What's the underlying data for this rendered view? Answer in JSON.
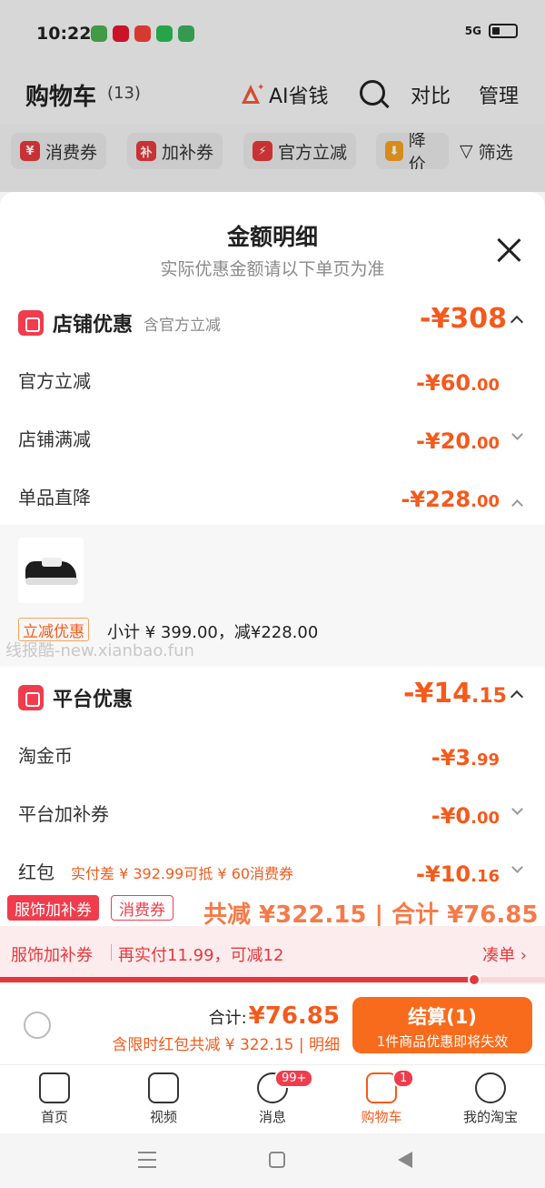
{
  "status": {
    "time": "10:22",
    "network": "5G"
  },
  "header": {
    "title": "购物车",
    "count": "(13)",
    "ai_label": "AI省钱",
    "compare": "对比",
    "manage": "管理"
  },
  "filters": [
    {
      "icon": "¥",
      "label": "消费券"
    },
    {
      "icon": "补",
      "label": "加补券"
    },
    {
      "icon": "⚡",
      "label": "官方立减"
    },
    {
      "icon": "⬇",
      "label": "降价"
    },
    {
      "icon": "▽",
      "label": "筛选"
    }
  ],
  "sheet": {
    "title": "金额明细",
    "subtitle": "实际优惠金额请以下单页为准",
    "store": {
      "title": "店铺优惠",
      "note": "含官方立减",
      "amount": "-¥308",
      "rows": [
        {
          "label": "官方立减",
          "amount_int": "-¥60",
          "amount_dec": ".00"
        },
        {
          "label": "店铺满减",
          "amount_int": "-¥20",
          "amount_dec": ".00"
        },
        {
          "label": "单品直降",
          "amount_int": "-¥228",
          "amount_dec": ".00"
        }
      ]
    },
    "product": {
      "tag": "立减优惠",
      "subtotal": "小计 ¥ 399.00，减¥228.00"
    },
    "watermark": "线报酷-new.xianbao.fun",
    "platform": {
      "title": "平台优惠",
      "amount_int": "-¥14",
      "amount_dec": ".15",
      "rows": [
        {
          "label": "淘金币",
          "amount_int": "-¥3",
          "amount_dec": ".99"
        },
        {
          "label": "平台加补券",
          "amount_int": "-¥0",
          "amount_dec": ".00"
        },
        {
          "label": "红包",
          "note": "实付差 ¥ 392.99可抵 ¥ 60消费券",
          "amount_int": "-¥10",
          "amount_dec": ".16"
        }
      ]
    }
  },
  "tags": {
    "red": "服饰加补券",
    "outline": "消费券",
    "peek": "共减 ¥322.15 | 合计 ¥76.85"
  },
  "promo": {
    "left": "服饰加补券",
    "mid": "再实付11.99，可减12",
    "right": "凑单 ›",
    "progress": 0.87
  },
  "checkout": {
    "total_label": "合计:",
    "total_value": "¥76.85",
    "discount": "含限时红包共减 ¥ 322.15 | 明细",
    "button_main": "结算(1)",
    "button_sub": "1件商品优惠即将失效"
  },
  "tabs": [
    {
      "label": "首页",
      "icon": "home-icon"
    },
    {
      "label": "视频",
      "icon": "video-icon"
    },
    {
      "label": "消息",
      "icon": "message-icon",
      "badge": "99+"
    },
    {
      "label": "购物车",
      "icon": "cart-icon",
      "badge": "1",
      "active": true
    },
    {
      "label": "我的淘宝",
      "icon": "profile-icon"
    }
  ],
  "colors": {
    "accent": "#f55a1c",
    "brand_red": "#f03c4c"
  }
}
